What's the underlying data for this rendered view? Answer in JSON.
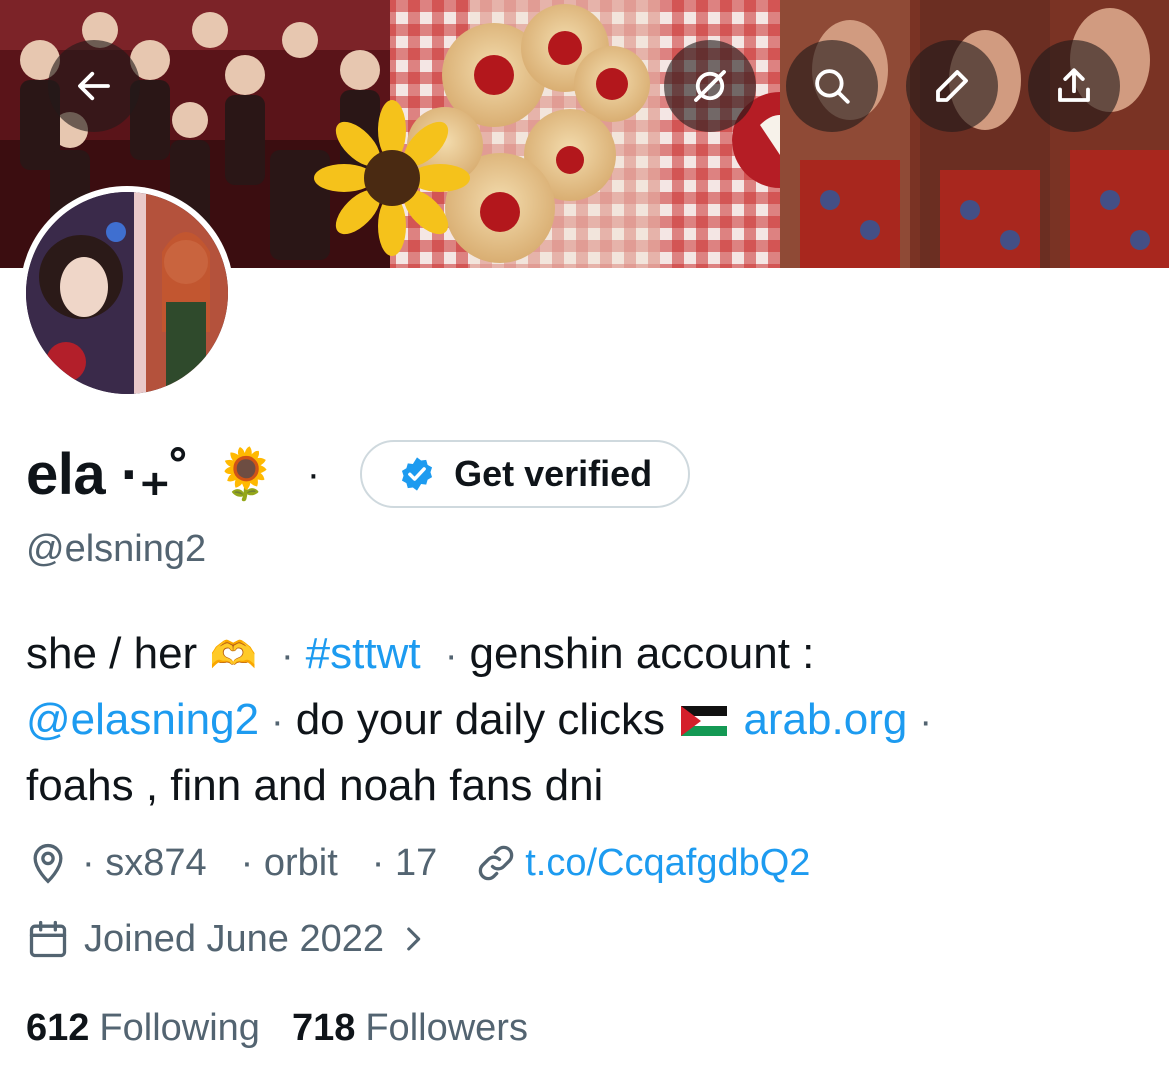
{
  "profile": {
    "name": "ela ·₊˚",
    "name_emoji": "🌻",
    "name_dot": "·",
    "handle": "@elsning2",
    "verify_label": "Get verified",
    "bio": {
      "l1_a": "she / her",
      "l1_emoji": "🫶",
      "dot": "·",
      "hashtag": "#sttwt",
      "l1_b": "genshin account :",
      "mention": "@elasning2",
      "l2_a": "do your daily clicks",
      "link": "arab.org",
      "l3": "foahs , finn and noah fans dni"
    },
    "location": "· sx874",
    "location2": "· orbit",
    "location3": "· 17",
    "url": "t.co/CcqafgdbQ2",
    "joined": "Joined June 2022",
    "following_count": "612",
    "following_label": "Following",
    "followers_count": "718",
    "followers_label": "Followers"
  },
  "colors": {
    "accent": "#1d9bf0",
    "secondary_text": "#536471",
    "primary_text": "#0f1419"
  },
  "icons": {
    "back": "arrow-left-icon",
    "grok": "grok-icon",
    "search": "search-icon",
    "edit": "pencil-icon",
    "share": "share-icon",
    "badge": "verified-badge-icon",
    "location": "location-pin-icon",
    "link": "link-icon",
    "calendar": "calendar-icon",
    "chevron": "chevron-right-icon"
  }
}
